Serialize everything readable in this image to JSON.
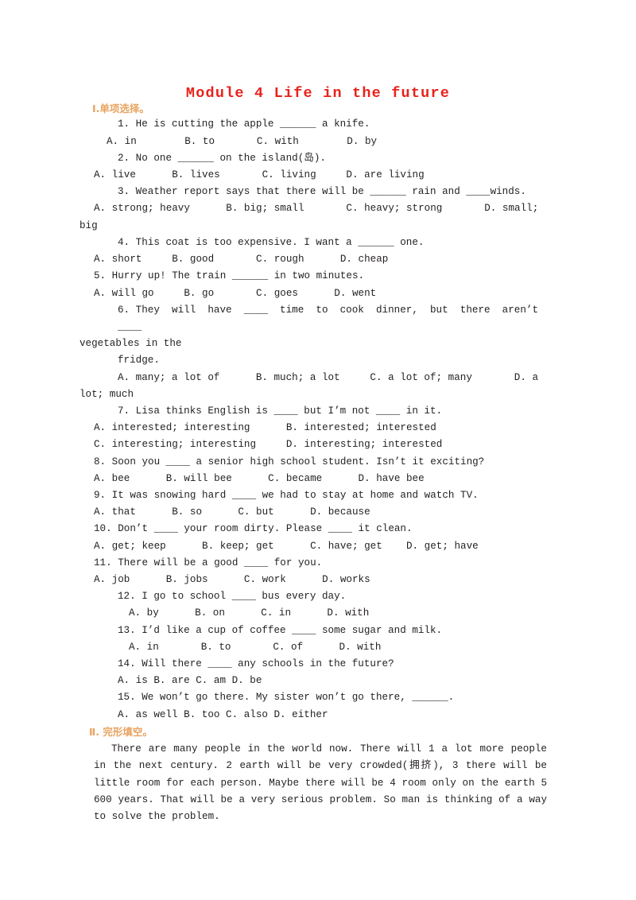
{
  "document": {
    "title": "Module 4  Life in the future",
    "title_color": "#e8221a",
    "section_color": "#e8a35f",
    "body_color": "#231f20"
  },
  "sections": [
    {
      "heading": "Ⅰ.单项选择。",
      "questions": [
        {
          "stem": "1. He is cutting the apple ______ a knife.",
          "options": "A. in        B. to       C. with        D. by"
        },
        {
          "stem": "2. No one ______ on the island(岛).",
          "options": "A. live      B. lives       C. living     D. are living"
        },
        {
          "stem": "3. Weather report says that there will be ______ rain and ____winds.",
          "options": "A. strong; heavy      B. big; small       C. heavy; strong       D. small;",
          "options_wrap": "big"
        },
        {
          "stem": "4. This coat is too expensive. I want a ______ one.",
          "options": "A. short     B. good       C. rough      D. cheap"
        },
        {
          "stem": "5. Hurry up! The train ______ in two minutes.",
          "options": "A. will go     B. go       C. goes      D. went"
        },
        {
          "stem": "6. They  will  have  ____  time  to  cook  dinner,  but  there  aren’t  ____",
          "stem_wrap": "vegetables in the",
          "stem_wrap2": "fridge.",
          "options": "A. many; a lot of      B. much; a lot     C. a lot of; many       D. a",
          "options_wrap": "lot; much"
        },
        {
          "stem": "7. Lisa thinks English is ____ but I’m not ____ in it.",
          "options": "A. interested; interesting      B. interested; interested",
          "options2": "C. interesting; interesting     D. interesting; interested"
        },
        {
          "stem": "8. Soon you ____ a senior high school student. Isn’t it exciting?",
          "options": "A. bee      B. will bee      C. became      D. have bee"
        },
        {
          "stem": "9. It was snowing hard ____ we had to stay at home and watch TV.",
          "options": "A. that      B. so      C. but      D. because"
        },
        {
          "stem": "10. Don’t ____ your room dirty. Please ____ it clean.",
          "options": "A. get; keep      B. keep; get      C. have; get    D. get; have"
        },
        {
          "stem": "11. There will be a good ____ for you.",
          "options": "A. job      B. jobs      C. work      D. works"
        },
        {
          "stem": "12. I go to school ____ bus every day.",
          "options": "A. by      B. on      C. in      D. with"
        },
        {
          "stem": "13. I’d like a cup of coffee ____ some sugar and milk.",
          "options": "A. in       B. to       C. of      D. with"
        },
        {
          "stem": "14. Will there ____ any schools in the future?",
          "options": "A. is B. are C. am D. be"
        },
        {
          "stem": "15. We won’t go there. My sister won’t go there, ______.",
          "options": "A. as well B. too C. also D. either"
        }
      ]
    },
    {
      "heading": "Ⅱ. 完形填空。",
      "passage": "There are many people in the world now. There will  1  a lot more people in the next century.  2  earth will be very crowded(拥挤),  3  there will be little room for each person. Maybe there will be  4  room only on the earth  5  600 years. That will be a very serious problem. So man is thinking of a way to solve the problem."
    }
  ]
}
